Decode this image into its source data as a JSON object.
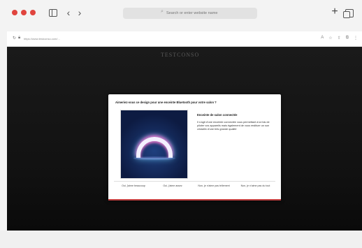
{
  "browser": {
    "search_placeholder": "Search or enter website name",
    "url": "https://www.testconso.com/..."
  },
  "site": {
    "logo_text": "TESTCONSO"
  },
  "modal": {
    "title": "Aimeriez-vous ce design pour une enceinte Bluetooth pour votre salon ?",
    "product_name": "Enceinte de salon connectée",
    "product_desc": "Il s'agit d'une enceinte connectée vous permettant à la fois de piloter vos appareils mais également de vous restituer un son cristallin d'une très grande qualité",
    "options": [
      "Oui, j'aime beaucoup",
      "Oui, j'aime assez",
      "Non, je n'aime pas tellement",
      "Non, je n'aime pas du tout"
    ]
  },
  "colors": {
    "accent": "#c74242",
    "traffic_red": "#e0443e"
  }
}
